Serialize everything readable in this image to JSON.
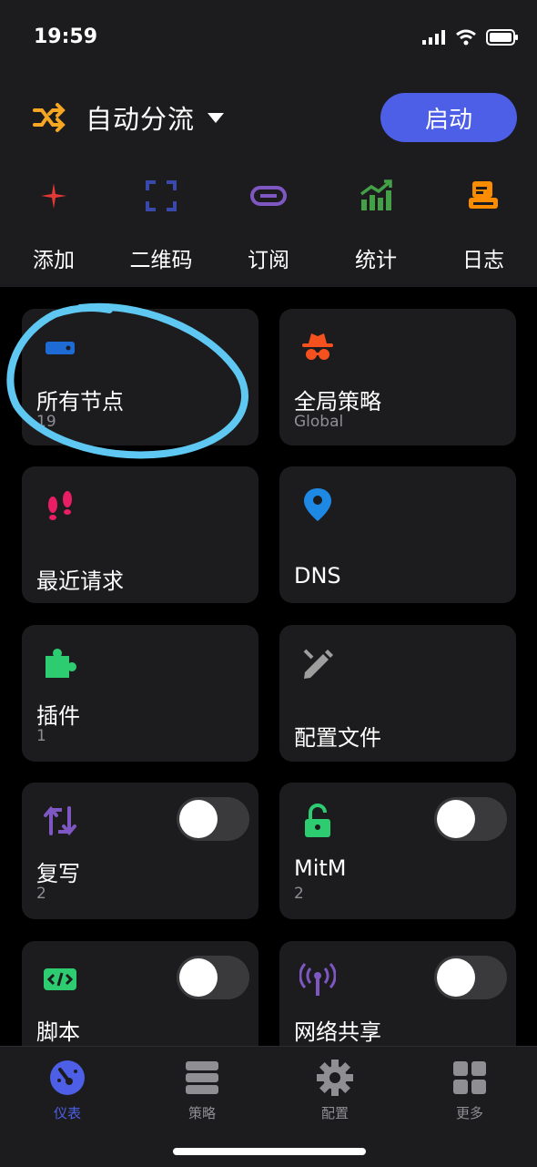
{
  "status": {
    "time": "19:59"
  },
  "header": {
    "mode_label": "自动分流",
    "start_label": "启动"
  },
  "quick_actions": [
    {
      "label": "添加",
      "icon": "plus-icon",
      "color": "#e53935"
    },
    {
      "label": "二维码",
      "icon": "qr-scan-icon",
      "color": "#3949ab"
    },
    {
      "label": "订阅",
      "icon": "link-icon",
      "color": "#7e57c2"
    },
    {
      "label": "统计",
      "icon": "chart-up-icon",
      "color": "#43a047"
    },
    {
      "label": "日志",
      "icon": "log-icon",
      "color": "#fb8c00"
    }
  ],
  "cards": {
    "all_nodes": {
      "title": "所有节点",
      "sub": "19"
    },
    "global_policy": {
      "title": "全局策略",
      "sub": "Global"
    },
    "recent_requests": {
      "title": "最近请求"
    },
    "dns": {
      "title": "DNS"
    },
    "plugins": {
      "title": "插件",
      "sub": "1"
    },
    "config_files": {
      "title": "配置文件"
    },
    "rewrite": {
      "title": "复写",
      "sub": "2",
      "enabled": false
    },
    "mitm": {
      "title": "MitM",
      "sub": "2",
      "enabled": false
    },
    "script": {
      "title": "脚本",
      "enabled": false
    },
    "network_share": {
      "title": "网络共享",
      "enabled": false
    }
  },
  "tabbar": [
    {
      "label": "仪表",
      "icon": "dashboard-icon",
      "active": true
    },
    {
      "label": "策略",
      "icon": "server-icon",
      "active": false
    },
    {
      "label": "配置",
      "icon": "gear-icon",
      "active": false
    },
    {
      "label": "更多",
      "icon": "grid-icon",
      "active": false
    }
  ],
  "colors": {
    "accent": "#4d5fe6",
    "card_bg": "#1c1c1e",
    "annotation": "#5ec8f2"
  }
}
